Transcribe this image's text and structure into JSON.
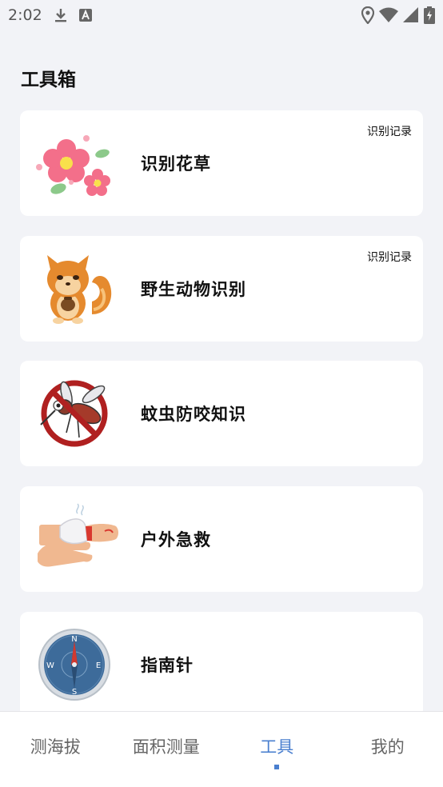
{
  "status_bar": {
    "time": "2:02"
  },
  "page_title": "工具箱",
  "tools": [
    {
      "label": "识别花草",
      "record": "识别记录",
      "icon": "flower-icon"
    },
    {
      "label": "野生动物识别",
      "record": "识别记录",
      "icon": "squirrel-icon"
    },
    {
      "label": "蚊虫防咬知识",
      "icon": "no-mosquito-icon"
    },
    {
      "label": "户外急救",
      "icon": "bandage-hand-icon"
    },
    {
      "label": "指南针",
      "icon": "compass-icon"
    }
  ],
  "compass_letters": {
    "n": "N",
    "e": "E",
    "s": "S",
    "w": "W"
  },
  "bottom_nav": {
    "tabs": [
      {
        "label": "测海拔"
      },
      {
        "label": "面积测量"
      },
      {
        "label": "工具",
        "active": true
      },
      {
        "label": "我的"
      }
    ]
  },
  "colors": {
    "accent": "#4a7fcf",
    "background": "#f2f3f7"
  }
}
